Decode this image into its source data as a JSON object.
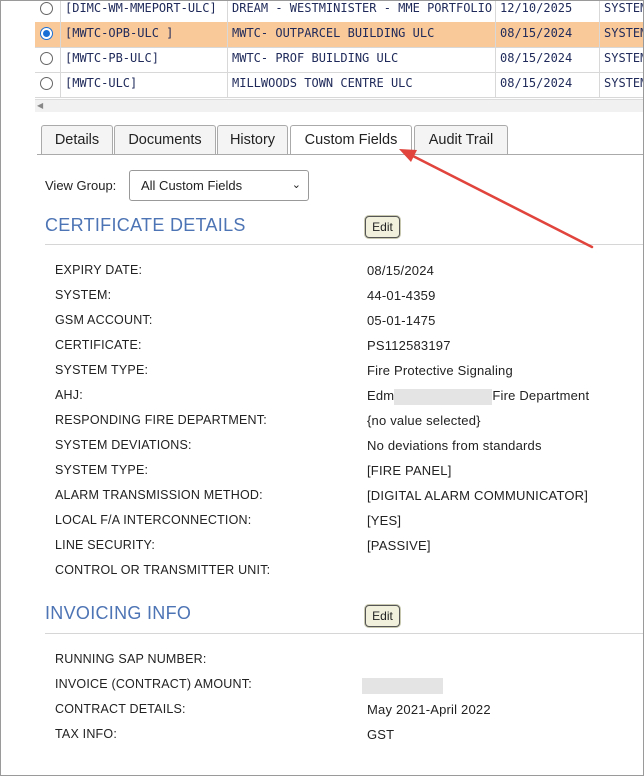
{
  "grid": {
    "rows": [
      {
        "selected": false,
        "code": "[DIMC-WM-MMEPORT-ULC]",
        "name": "DREAM - WESTMINISTER - MME PORTFOLIO",
        "date": "12/10/2025",
        "system": "SYSTEM"
      },
      {
        "selected": true,
        "code": "[MWTC-OPB-ULC ]",
        "name": "MWTC- OUTPARCEL BUILDING ULC",
        "date": "08/15/2024",
        "system": "SYSTEM"
      },
      {
        "selected": false,
        "code": "[MWTC-PB-ULC]",
        "name": "MWTC- PROF BUILDING ULC",
        "date": "08/15/2024",
        "system": "SYSTEM"
      },
      {
        "selected": false,
        "code": "[MWTC-ULC]",
        "name": "MILLWOODS TOWN CENTRE ULC",
        "date": "08/15/2024",
        "system": "SYSTEM"
      }
    ]
  },
  "tabs": [
    "Details",
    "Documents",
    "History",
    "Custom Fields",
    "Audit Trail"
  ],
  "active_tab": "Custom Fields",
  "view_group": {
    "label": "View Group:",
    "selected": "All Custom Fields"
  },
  "certificate": {
    "title": "CERTIFICATE DETAILS",
    "edit_label": "Edit",
    "fields": [
      {
        "label": "EXPIRY DATE:",
        "value": "08/15/2024"
      },
      {
        "label": "SYSTEM:",
        "value": "44-01-4359"
      },
      {
        "label": "GSM ACCOUNT:",
        "value": "05-01-1475"
      },
      {
        "label": "CERTIFICATE:",
        "value": "PS112583197"
      },
      {
        "label": "SYSTEM TYPE:",
        "value": "Fire Protective Signaling"
      },
      {
        "label": "AHJ:",
        "value_prefix": "Edm",
        "value_suffix": "Fire Department"
      },
      {
        "label": "RESPONDING FIRE DEPARTMENT:",
        "value": "{no value selected}"
      },
      {
        "label": "SYSTEM DEVIATIONS:",
        "value": "No deviations from standards"
      },
      {
        "label": "SYSTEM TYPE:",
        "value": "[FIRE PANEL]"
      },
      {
        "label": "ALARM TRANSMISSION METHOD:",
        "value": "[DIGITAL ALARM COMMUNICATOR]"
      },
      {
        "label": "LOCAL F/A INTERCONNECTION:",
        "value": "[YES]"
      },
      {
        "label": "LINE SECURITY:",
        "value": "[PASSIVE]"
      },
      {
        "label": "CONTROL OR TRANSMITTER UNIT:",
        "value": ""
      }
    ]
  },
  "invoicing": {
    "title": "INVOICING INFO",
    "edit_label": "Edit",
    "fields": [
      {
        "label": "RUNNING SAP NUMBER:",
        "value": ""
      },
      {
        "label": "INVOICE (CONTRACT) AMOUNT:",
        "value": ""
      },
      {
        "label": "CONTRACT DETAILS:",
        "value": "May 2021-April 2022"
      },
      {
        "label": "TAX INFO:",
        "value": "GST"
      }
    ]
  },
  "colors": {
    "accent": "#4d74b4",
    "selected_row": "#f9c99a",
    "annotation_arrow": "#e0443c"
  }
}
